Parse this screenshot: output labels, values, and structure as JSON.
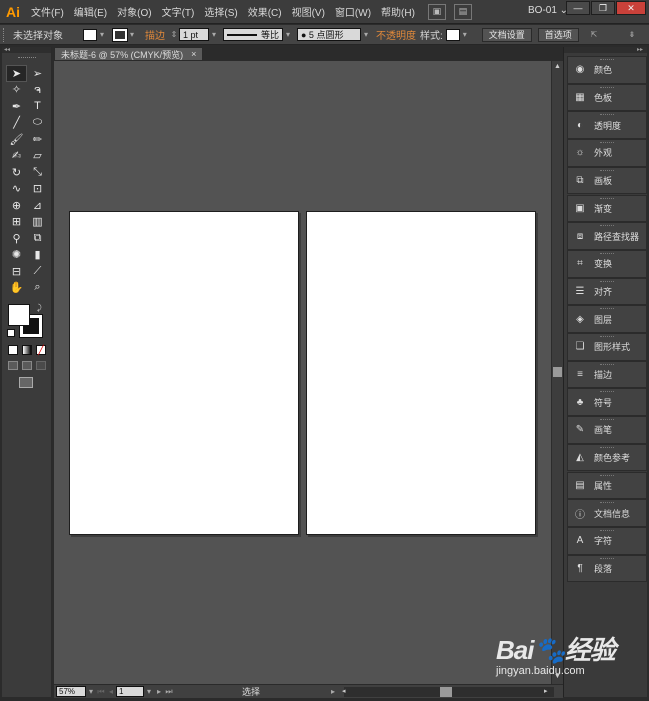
{
  "app": {
    "logo": "Ai",
    "workspace": "BO-01 ⌄"
  },
  "menu": [
    "文件(F)",
    "编辑(E)",
    "对象(O)",
    "文字(T)",
    "选择(S)",
    "效果(C)",
    "视图(V)",
    "窗口(W)",
    "帮助(H)"
  ],
  "window_buttons": [
    "—",
    "❐",
    "✕"
  ],
  "control_bar": {
    "selection": "未选择对象",
    "stroke_label": "描边",
    "stroke_weight": "1 pt",
    "stroke_profile": "等比",
    "brush": "● 5 点圆形",
    "opacity_label": "不透明度",
    "style_label": "样式:",
    "doc_setup_button": "文档设置",
    "preferences_button": "首选项"
  },
  "document": {
    "tab_title": "未标题-6 @ 57% (CMYK/预览)",
    "close": "×"
  },
  "status_bar": {
    "zoom": "57%",
    "artboard_number": "1",
    "current_tool": "选择"
  },
  "panels": [
    {
      "label": "颜色",
      "icon": "color-icon",
      "glyph": "◉"
    },
    {
      "label": "色板",
      "icon": "swatches-icon",
      "glyph": "▦"
    },
    {
      "label": "透明度",
      "icon": "transparency-icon",
      "glyph": "◐"
    },
    {
      "label": "外观",
      "icon": "appearance-icon",
      "glyph": "☼"
    },
    {
      "label": "画板",
      "icon": "artboards-icon",
      "glyph": "⧉"
    },
    {
      "label": "渐变",
      "icon": "gradient-icon",
      "glyph": "▣"
    },
    {
      "label": "路径查找器",
      "icon": "pathfinder-icon",
      "glyph": "⧈"
    },
    {
      "label": "变换",
      "icon": "transform-icon",
      "glyph": "⌗"
    },
    {
      "label": "对齐",
      "icon": "align-icon",
      "glyph": "☰"
    },
    {
      "label": "图层",
      "icon": "layers-icon",
      "glyph": "◈"
    },
    {
      "label": "图形样式",
      "icon": "graphic-styles-icon",
      "glyph": "❏"
    },
    {
      "label": "描边",
      "icon": "stroke-icon",
      "glyph": "≡"
    },
    {
      "label": "符号",
      "icon": "symbols-icon",
      "glyph": "♣"
    },
    {
      "label": "画笔",
      "icon": "brushes-icon",
      "glyph": "✎"
    },
    {
      "label": "颜色参考",
      "icon": "color-guide-icon",
      "glyph": "◭"
    },
    {
      "label": "属性",
      "icon": "attributes-icon",
      "glyph": "▤"
    },
    {
      "label": "文档信息",
      "icon": "document-info-icon",
      "glyph": "ⓘ"
    },
    {
      "label": "字符",
      "icon": "character-icon",
      "glyph": "A"
    },
    {
      "label": "段落",
      "icon": "paragraph-icon",
      "glyph": "¶"
    }
  ],
  "tools": [
    {
      "name": "selection-tool-icon",
      "glyph": "➤",
      "selected": true
    },
    {
      "name": "direct-selection-tool-icon",
      "glyph": "➢"
    },
    {
      "name": "magic-wand-tool-icon",
      "glyph": "✧"
    },
    {
      "name": "lasso-tool-icon",
      "glyph": "ຈ"
    },
    {
      "name": "pen-tool-icon",
      "glyph": "✒"
    },
    {
      "name": "type-tool-icon",
      "glyph": "T"
    },
    {
      "name": "line-segment-tool-icon",
      "glyph": "╱"
    },
    {
      "name": "ellipse-tool-icon",
      "glyph": "⬭"
    },
    {
      "name": "paintbrush-tool-icon",
      "glyph": "🖌"
    },
    {
      "name": "pencil-tool-icon",
      "glyph": "✏"
    },
    {
      "name": "blob-brush-tool-icon",
      "glyph": "✍"
    },
    {
      "name": "eraser-tool-icon",
      "glyph": "▱"
    },
    {
      "name": "rotate-tool-icon",
      "glyph": "↻"
    },
    {
      "name": "scale-tool-icon",
      "glyph": "⤡"
    },
    {
      "name": "warp-tool-icon",
      "glyph": "∿"
    },
    {
      "name": "free-transform-tool-icon",
      "glyph": "⊡"
    },
    {
      "name": "shape-builder-tool-icon",
      "glyph": "⊕"
    },
    {
      "name": "perspective-grid-tool-icon",
      "glyph": "⊿"
    },
    {
      "name": "mesh-tool-icon",
      "glyph": "⊞"
    },
    {
      "name": "gradient-tool-icon",
      "glyph": "▥"
    },
    {
      "name": "eyedropper-tool-icon",
      "glyph": "⚲"
    },
    {
      "name": "blend-tool-icon",
      "glyph": "⧉"
    },
    {
      "name": "symbol-sprayer-tool-icon",
      "glyph": "✺"
    },
    {
      "name": "column-graph-tool-icon",
      "glyph": "▮"
    },
    {
      "name": "artboard-tool-icon",
      "glyph": "⊟"
    },
    {
      "name": "slice-tool-icon",
      "glyph": "⟋"
    },
    {
      "name": "hand-tool-icon",
      "glyph": "✋"
    },
    {
      "name": "zoom-tool-icon",
      "glyph": "⌕"
    }
  ],
  "colors": {
    "ui_dark": "#3c3c3c",
    "canvas": "#535353",
    "artboard": "#ffffff",
    "logo": "#ff9a00",
    "opacity_link": "#e0883a"
  }
}
